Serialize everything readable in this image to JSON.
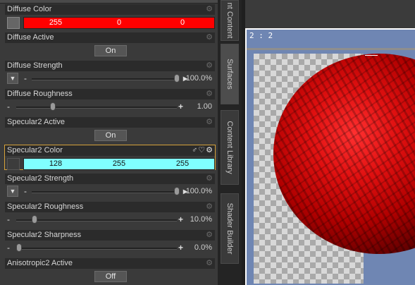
{
  "surfaces": {
    "diffuse_color": {
      "label": "Diffuse Color",
      "r": "255",
      "g": "0",
      "b": "0",
      "color": "#ff0000"
    },
    "diffuse_active": {
      "label": "Diffuse Active",
      "button": "On"
    },
    "diffuse_strength": {
      "label": "Diffuse Strength",
      "value": "100.0%",
      "fraction": 1.0
    },
    "diffuse_roughness": {
      "label": "Diffuse Roughness",
      "value": "1.00",
      "fraction": 0.22
    },
    "specular2_active": {
      "label": "Specular2 Active",
      "button": "On"
    },
    "specular2_color": {
      "label": "Specular2 Color",
      "r": "128",
      "g": "255",
      "b": "255",
      "color": "#80ffff"
    },
    "specular2_strength": {
      "label": "Specular2 Strength",
      "value": "100.0%",
      "fraction": 1.0
    },
    "specular2_roughness": {
      "label": "Specular2 Roughness",
      "value": "10.0%",
      "fraction": 0.1
    },
    "specular2_sharpness": {
      "label": "Specular2 Sharpness",
      "value": "0.0%",
      "fraction": 0.0
    },
    "anisotropic2_active": {
      "label": "Anisotropic2 Active",
      "button": "Off"
    }
  },
  "dock_tabs": [
    {
      "label": "nt Content",
      "active": false
    },
    {
      "label": "Surfaces",
      "active": true
    },
    {
      "label": "Content Library",
      "active": false
    },
    {
      "label": "Shader Builder",
      "active": false
    }
  ],
  "viewport": {
    "label": "2 : 2"
  },
  "colors": {
    "selected_border": "#d6a23a",
    "sphere": "#c00000",
    "viewport_bg": "#6f86b3"
  }
}
